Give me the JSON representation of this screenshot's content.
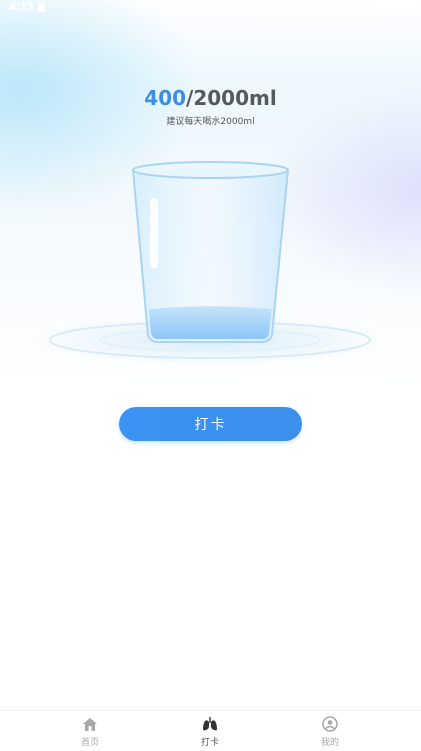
{
  "status_bar": {
    "time": "4:13",
    "icons": [
      "document-icon",
      "wifi-icon",
      "signal-icon",
      "battery-icon"
    ]
  },
  "water": {
    "current": "400",
    "separator_goal": "/2000ml",
    "suggestion": "建议每天喝水2000ml",
    "fill_fraction": 0.2
  },
  "checkin_button": {
    "label": "打卡"
  },
  "tabbar": {
    "tabs": [
      {
        "label": "首页",
        "icon": "home-icon",
        "active": false
      },
      {
        "label": "打卡",
        "icon": "lungs-icon",
        "active": true
      },
      {
        "label": "我的",
        "icon": "profile-icon",
        "active": false
      }
    ]
  },
  "colors": {
    "accent": "#3c8ee0",
    "button": "#3c92f2",
    "text_dark": "#555a61",
    "tab_inactive": "#a8a8a8",
    "water": "#9fd0fa"
  }
}
